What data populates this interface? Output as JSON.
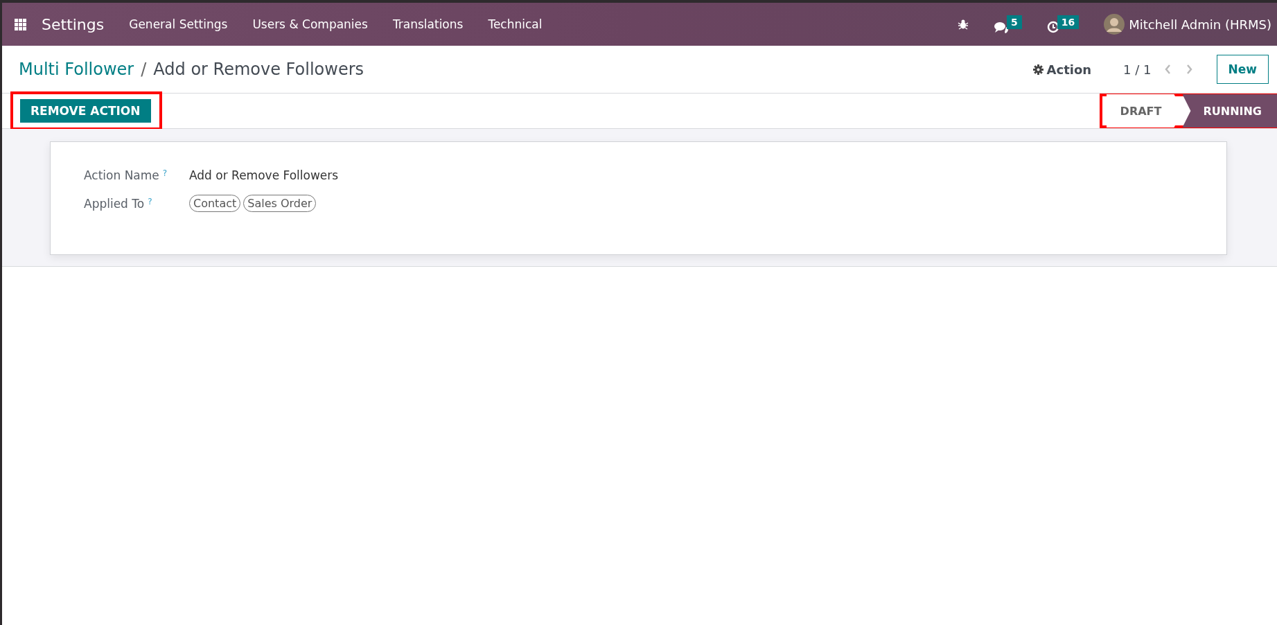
{
  "navbar": {
    "app": "Settings",
    "menus": [
      "General Settings",
      "Users & Companies",
      "Translations",
      "Technical"
    ],
    "messages_count": "5",
    "activities_count": "16",
    "user": "Mitchell Admin (HRMS)"
  },
  "breadcrumb": {
    "parent": "Multi Follower",
    "separator": "/",
    "current": "Add or Remove Followers"
  },
  "control": {
    "action": "Action",
    "pager": "1 / 1",
    "new": "New"
  },
  "buttons": [
    {
      "label": "REMOVE ACTION",
      "highlighted": true
    }
  ],
  "statusbar": {
    "highlighted": true,
    "stages": [
      {
        "label": "DRAFT",
        "selected": false
      },
      {
        "label": "RUNNING",
        "selected": true
      }
    ]
  },
  "form": {
    "fields": [
      {
        "label": "Action Name",
        "help": "?",
        "kind": "text",
        "value": "Add or Remove Followers"
      },
      {
        "label": "Applied To",
        "help": "?",
        "kind": "tags",
        "tags": [
          "Contact",
          "Sales Order"
        ]
      }
    ]
  }
}
